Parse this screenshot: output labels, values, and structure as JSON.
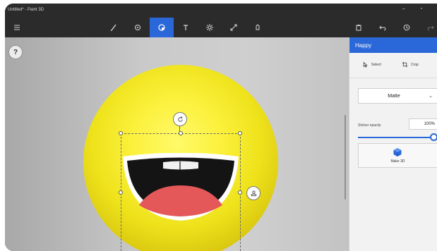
{
  "window": {
    "title": "Untitled* - Paint 3D"
  },
  "toolbar": {
    "active_tool": "stickers"
  },
  "canvas": {
    "help_label": "?"
  },
  "panel": {
    "header": "Happy",
    "select_label": "Select",
    "crop_label": "Crop",
    "finish_value": "Matte",
    "opacity_label": "Sticker opacity",
    "opacity_value": "100%",
    "opacity_level": 1.0,
    "make3d_label": "Make 3D"
  },
  "colors": {
    "accent": "#2a67d8",
    "toolbar_bg": "#2b2b2b",
    "sticker_yellow": "#f3e62a",
    "mouth_red": "#e4585a"
  }
}
